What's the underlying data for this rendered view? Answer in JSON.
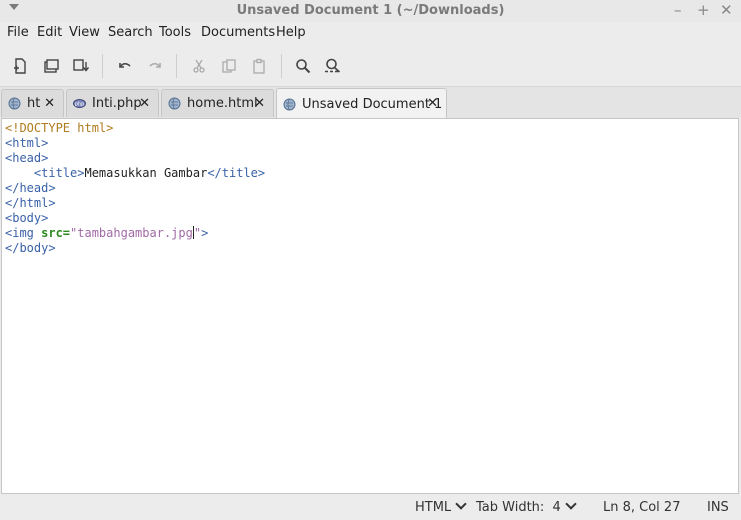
{
  "window": {
    "title": "Unsaved Document 1 (~/Downloads)",
    "controls": {
      "minimize": "–",
      "maximize": "+",
      "close": "✕"
    }
  },
  "menu": [
    "File",
    "Edit",
    "View",
    "Search",
    "Tools",
    "Documents",
    "Help"
  ],
  "toolbar": {
    "buttons": [
      "new-document",
      "open",
      "save",
      "undo",
      "redo",
      "cut",
      "copy",
      "paste",
      "find",
      "find-replace"
    ]
  },
  "tabs": [
    {
      "label": "ht",
      "icon": "html-file-icon",
      "close": "✕"
    },
    {
      "label": "Inti.php",
      "icon": "php-file-icon",
      "close": "✕"
    },
    {
      "label": "home.html",
      "icon": "html-file-icon",
      "close": "✕"
    },
    {
      "label": "Unsaved Document 1",
      "icon": "html-file-icon",
      "close": "✕",
      "active": true
    }
  ],
  "editor": {
    "lines": [
      [
        {
          "t": "<!DOCTYPE html>",
          "c": "doctype"
        }
      ],
      [
        {
          "t": "<html>",
          "c": "tag"
        }
      ],
      [
        {
          "t": "<head>",
          "c": "tag"
        }
      ],
      [
        {
          "t": "    ",
          "c": "text"
        },
        {
          "t": "<title>",
          "c": "tag"
        },
        {
          "t": "Memasukkan Gambar",
          "c": "text"
        },
        {
          "t": "</title>",
          "c": "tag"
        }
      ],
      [
        {
          "t": "</head>",
          "c": "tag"
        }
      ],
      [
        {
          "t": "</html>",
          "c": "tag"
        }
      ],
      [
        {
          "t": "<body>",
          "c": "tag"
        }
      ],
      [
        {
          "t": "<img ",
          "c": "tag"
        },
        {
          "t": "src=",
          "c": "attr"
        },
        {
          "t": "\"tambahgambar.jpg",
          "c": "str"
        },
        {
          "t": "|",
          "c": "caret"
        },
        {
          "t": "\"",
          "c": "str"
        },
        {
          "t": ">",
          "c": "tag"
        }
      ],
      [
        {
          "t": "</body>",
          "c": "tag"
        }
      ]
    ],
    "colors": {
      "doctype": "#b07b1f",
      "tag": "#3a62a8",
      "attr": "#2d8a1f",
      "str": "#a06aa4",
      "text": "#222222"
    }
  },
  "status": {
    "language": "HTML",
    "tab_width": "Tab Width:  4",
    "position": "Ln 8, Col 27",
    "mode": "INS"
  }
}
